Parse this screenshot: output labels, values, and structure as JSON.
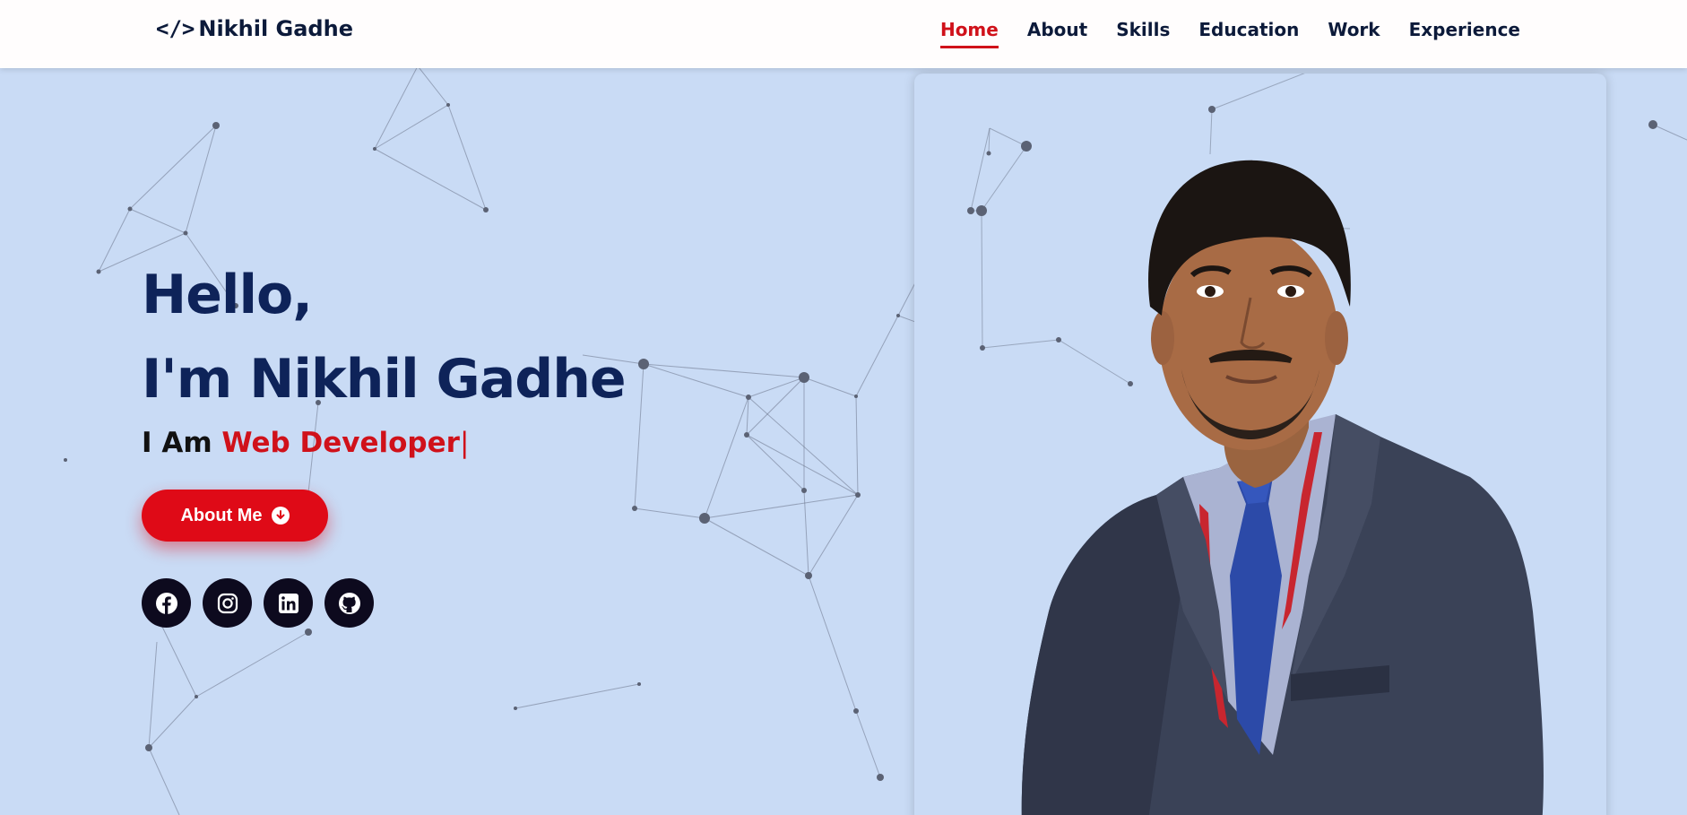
{
  "brand": {
    "icon": "code-icon",
    "name": "Nikhil Gadhe"
  },
  "nav": {
    "items": [
      {
        "label": "Home",
        "active": true
      },
      {
        "label": "About"
      },
      {
        "label": "Skills"
      },
      {
        "label": "Education"
      },
      {
        "label": "Work"
      },
      {
        "label": "Experience"
      }
    ]
  },
  "hero": {
    "greeting": "Hello,",
    "name_line": "I'm Nikhil Gadhe",
    "prefix": "I Am",
    "role": "Web Developer",
    "caret": "|",
    "button_label": "About Me",
    "button_icon": "arrow-down-circle-icon"
  },
  "socials": [
    "facebook-icon",
    "instagram-icon",
    "linkedin-icon",
    "github-icon"
  ],
  "colors": {
    "accent": "#d0111a",
    "heading": "#0e2359",
    "background": "#c9dbf5",
    "header_bg": "#fffdfd",
    "social_bg": "#0d0a1e"
  }
}
